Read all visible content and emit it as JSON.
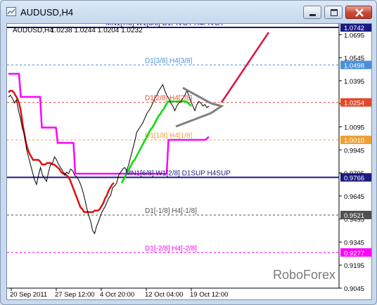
{
  "window": {
    "title": "AUDUSD,H4",
    "buttons": {
      "minimize": "minimize",
      "maximize": "maximize",
      "close": "close"
    }
  },
  "chart_header": {
    "symbol": "AUDUSD,H4",
    "ohlc": "1.0238 1.0244 1.0204 1.0232"
  },
  "watermark": "RoboForex",
  "price_badges": [
    {
      "value": "1.0742",
      "color": "#1a1a80"
    },
    {
      "value": "1.0498",
      "color": "#4a90d9"
    },
    {
      "value": "1.0254",
      "color": "#e04a2a"
    },
    {
      "value": "1.0010",
      "color": "#f0a030"
    },
    {
      "value": "0.9766",
      "color": "#1a1a80"
    },
    {
      "value": "0.9521",
      "color": "#505050"
    },
    {
      "value": "0.9277",
      "color": "#ff00ff"
    }
  ],
  "level_labels": [
    {
      "text": "MN1[7/8] W1[3/8] D1PIVOT H4PIVOT",
      "color": "#1a1a80"
    },
    {
      "text": "D1[3/8] H4[3/8]",
      "color": "#4a90d9"
    },
    {
      "text": "D1[2/8] H4[2/8]",
      "color": "#e04a2a"
    },
    {
      "text": "D1[1/8] H4[1/8]",
      "color": "#f0a030"
    },
    {
      "text": "MN1[6/8] W1[2/8] D1SUP H4SUP",
      "color": "#1a1a80"
    },
    {
      "text": "D1[-1/8] H4[-1/8]",
      "color": "#505050"
    },
    {
      "text": "D1[-2/8] H4[-2/8]",
      "color": "#ff00ff"
    }
  ],
  "y_axis": {
    "ticks": [
      "1.0695",
      "1.0545",
      "1.0395",
      "1.0245",
      "1.0095",
      "0.9945",
      "0.9795",
      "0.9645",
      "0.9495",
      "0.9345",
      "0.9195",
      "0.9045"
    ]
  },
  "x_axis": {
    "ticks": [
      "20 Sep 2011",
      "27 Sep 12:00",
      "4 Oct 20:00",
      "12 Oct 04:00",
      "19 Oct 12:00"
    ]
  },
  "chart_data": {
    "type": "line",
    "title": "AUDUSD,H4",
    "xlabel": "",
    "ylabel": "",
    "ylim": [
      0.9045,
      1.0765
    ],
    "price_levels": [
      1.0742,
      1.0498,
      1.0254,
      1.001,
      0.9766,
      0.9521,
      0.9277
    ],
    "x_ticks": [
      "20 Sep 2011",
      "27 Sep 12:00",
      "4 Oct 20:00",
      "12 Oct 04:00",
      "19 Oct 12:00"
    ],
    "series": [
      {
        "color": "#ff00ff",
        "values": [
          1.044,
          1.044,
          1.044,
          1.044,
          1.044,
          1.044,
          1.044,
          1.029,
          1.029,
          1.029,
          1.029,
          1.029,
          1.029,
          1.029,
          1.029,
          1.029,
          1.029,
          1.029,
          1.029,
          1.009,
          1.009,
          1.009,
          1.009,
          1.009,
          1.009,
          1.009,
          1.009,
          1.009,
          0.999,
          0.999,
          0.999,
          0.999,
          0.999,
          0.999,
          0.999,
          0.999,
          0.999,
          0.999,
          0.979,
          0.979,
          0.979,
          0.979,
          0.979,
          0.979,
          0.979,
          0.979,
          0.979,
          0.979,
          0.979,
          0.979,
          0.979,
          0.979,
          0.979,
          0.979,
          0.979,
          0.979,
          0.979,
          0.979,
          0.979,
          0.979,
          0.979,
          0.979,
          0.979,
          0.979,
          0.979,
          0.979,
          0.979,
          0.979,
          0.979,
          0.979,
          0.979,
          0.979,
          0.979,
          0.979,
          0.979,
          0.979,
          0.979,
          0.979,
          0.979,
          0.979,
          0.979,
          0.979,
          0.979,
          0.979,
          0.979,
          0.979,
          0.979,
          0.979,
          0.979,
          0.979,
          0.979,
          1.001,
          1.001,
          1.001,
          1.001,
          1.001,
          1.001,
          1.001,
          1.001,
          1.001,
          1.001,
          1.001,
          1.001,
          1.001,
          1.001,
          1.001,
          1.001,
          1.001,
          1.001,
          1.001,
          1.001,
          1.001,
          1.001,
          1.002,
          1.003
        ]
      },
      {
        "color": "#e01010",
        "values": [
          1.032,
          1.033,
          1.033,
          1.032,
          1.03,
          1.028,
          1.025,
          1.02,
          1.012,
          1.005,
          0.999,
          0.995,
          0.992,
          0.99,
          0.988,
          0.988,
          0.988,
          0.988,
          0.987,
          0.985,
          0.985,
          0.985,
          0.986,
          0.986,
          0.986,
          0.985,
          0.985,
          0.984,
          0.983,
          0.982,
          0.98,
          0.979,
          0.979,
          0.978,
          0.977,
          0.975,
          0.972,
          0.969,
          0.966,
          0.963,
          0.96,
          0.957,
          0.956,
          0.954,
          0.954,
          0.954,
          0.954,
          0.954,
          0.954,
          0.955,
          0.955,
          0.955,
          0.956,
          0.958,
          0.96,
          0.963,
          0.965,
          0.968,
          0.97,
          0.972,
          0.973
        ]
      },
      {
        "color": "#00dd00",
        "values": [
          0.973,
          0.975,
          0.977,
          0.979,
          0.981,
          0.983,
          0.985,
          0.987,
          0.988,
          0.99,
          0.992,
          0.994,
          0.996,
          0.998,
          1.0,
          1.002,
          1.004,
          1.006,
          1.008,
          1.009,
          1.011,
          1.013,
          1.015,
          1.017,
          1.018,
          1.02,
          1.021,
          1.023,
          1.025,
          1.026,
          1.026,
          1.026,
          1.026,
          1.026,
          1.026,
          1.026,
          1.026,
          1.026,
          1.026,
          1.026,
          1.026,
          1.025,
          1.024,
          1.023
        ]
      },
      {
        "color": "#000000",
        "values": [
          1.029,
          1.03,
          1.028,
          1.025,
          1.027,
          1.02,
          1.015,
          1.008,
          1.005,
          0.995,
          0.99,
          0.985,
          0.98,
          0.975,
          0.972,
          0.978,
          0.983,
          0.978,
          0.976,
          0.974,
          0.98,
          0.985,
          0.986,
          0.99,
          0.988,
          0.985,
          0.983,
          0.981,
          0.978,
          0.98,
          0.979,
          0.982,
          0.981,
          0.978,
          0.977,
          0.975,
          0.972,
          0.968,
          0.963,
          0.957,
          0.952,
          0.948,
          0.942,
          0.94,
          0.945,
          0.948,
          0.952,
          0.955,
          0.957,
          0.96,
          0.963,
          0.965,
          0.97,
          0.971,
          0.973,
          0.978,
          0.98,
          0.982,
          0.983,
          0.981,
          0.985,
          0.99,
          0.995,
          1.0,
          1.006,
          1.008,
          1.01,
          1.012,
          1.015,
          1.018,
          1.02,
          1.022,
          1.025,
          1.028,
          1.03,
          1.033,
          1.035,
          1.037,
          1.033,
          1.03,
          1.028,
          1.025,
          1.023,
          1.02,
          1.023,
          1.025,
          1.026,
          1.028,
          1.03,
          1.033,
          1.03,
          1.026,
          1.023,
          1.02,
          1.024,
          1.026,
          1.025,
          1.023,
          1.024,
          1.022,
          1.023
        ]
      }
    ],
    "forecast": [
      {
        "x": "19 Oct 12:00",
        "y": 1.0254
      },
      {
        "y": 1.071
      }
    ]
  }
}
